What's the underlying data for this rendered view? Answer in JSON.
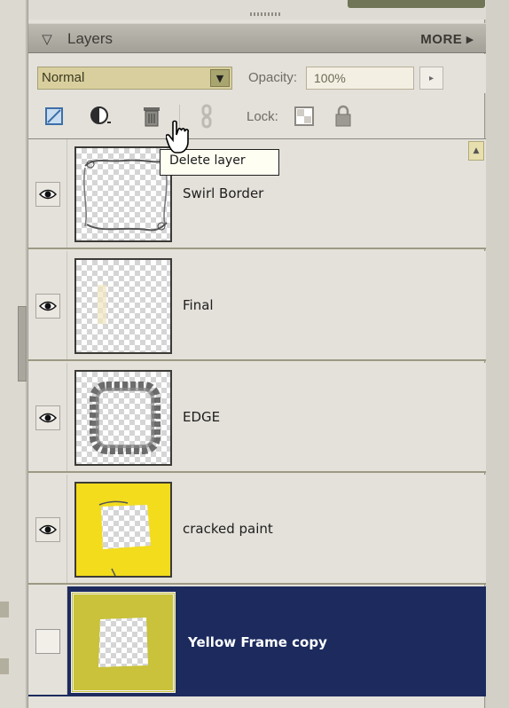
{
  "panel": {
    "title": "Layers",
    "more_label": "MORE"
  },
  "blend": {
    "mode": "Normal",
    "opacity_label": "Opacity:",
    "opacity_value": "100%"
  },
  "toolbar": {
    "lock_label": "Lock:",
    "icons": [
      "new-layer-icon",
      "adjustment-layer-icon",
      "trash-icon",
      "link-icon",
      "lock-transparency-icon",
      "lock-icon"
    ]
  },
  "tooltip": "Delete layer",
  "layers": [
    {
      "name": "Swirl Border",
      "visible": true,
      "selected": false
    },
    {
      "name": "Final",
      "visible": true,
      "selected": false
    },
    {
      "name": "EDGE",
      "visible": true,
      "selected": false
    },
    {
      "name": "cracked paint",
      "visible": true,
      "selected": false
    },
    {
      "name": "Yellow Frame copy",
      "visible": false,
      "selected": true
    }
  ],
  "colors": {
    "selected_row": "#1c2a5e",
    "blend_select": "#d9cf9e",
    "yellow_thumb": "#f2dc1c",
    "olive_thumb": "#c9c23a"
  }
}
